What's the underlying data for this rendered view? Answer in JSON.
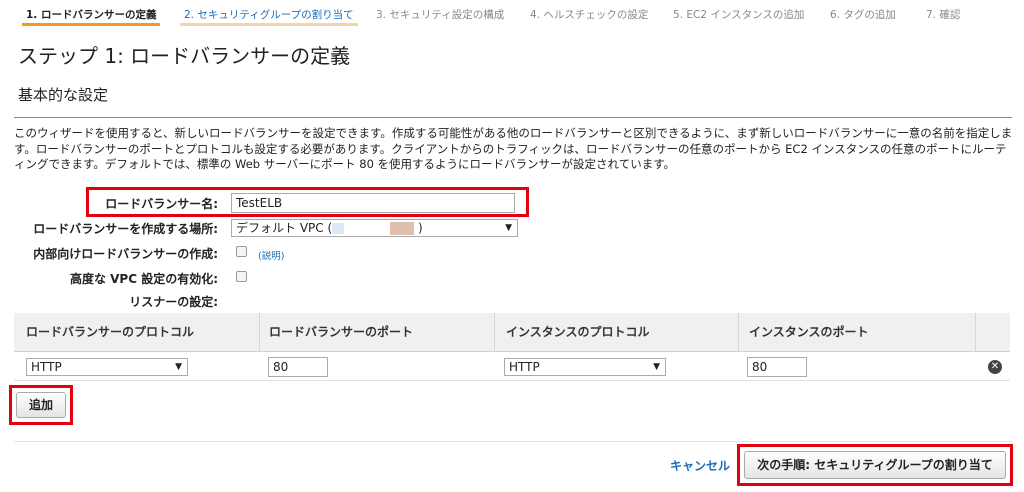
{
  "tabs": [
    {
      "label": "1. ロードバランサーの定義",
      "state": "active"
    },
    {
      "label": "2. セキュリティグループの割り当て",
      "state": "link"
    },
    {
      "label": "3. セキュリティ設定の構成",
      "state": "inactive"
    },
    {
      "label": "4. ヘルスチェックの設定",
      "state": "inactive"
    },
    {
      "label": "5. EC2 インスタンスの追加",
      "state": "inactive"
    },
    {
      "label": "6. タグの追加",
      "state": "inactive"
    },
    {
      "label": "7. 確認",
      "state": "inactive"
    }
  ],
  "page": {
    "title": "ステップ 1: ロードバランサーの定義",
    "section_title": "基本的な設定",
    "description": "このウィザードを使用すると、新しいロードバランサーを設定できます。作成する可能性がある他のロードバランサーと区別できるように、まず新しいロードバランサーに一意の名前を指定します。ロードバランサーのポートとプロトコルも設定する必要があります。クライアントからのトラフィックは、ロードバランサーの任意のポートから EC2 インスタンスの任意のポートにルーティングできます。デフォルトでは、標準の Web サーバーにポート 80 を使用するようにロードバランサーが設定されています。"
  },
  "form": {
    "name_label": "ロードバランサー名:",
    "name_value": "TestELB",
    "location_label": "ロードバランサーを作成する場所:",
    "location_value": "デフォルト VPC (",
    "location_value_end": ")",
    "internal_label": "内部向けロードバランサーの作成:",
    "internal_help": "(説明)",
    "internal_checked": false,
    "advanced_vpc_label": "高度な VPC 設定の有効化:",
    "advanced_vpc_checked": false,
    "listeners_label": "リスナーの設定:"
  },
  "listeners": {
    "headers": [
      "ロードバランサーのプロトコル",
      "ロードバランサーのポート",
      "インスタンスのプロトコル",
      "インスタンスのポート"
    ],
    "rows": [
      {
        "lb_protocol": "HTTP",
        "lb_port": "80",
        "instance_protocol": "HTTP",
        "instance_port": "80"
      }
    ],
    "add_button": "追加"
  },
  "footer": {
    "cancel_label": "キャンセル",
    "next_label": "次の手順: セキュリティグループの割り当て"
  },
  "colors": {
    "accent_orange": "#f49b1b",
    "link_blue": "#1a6db8",
    "highlight_red": "#e3000f"
  },
  "icons": {
    "remove": "close-circle-icon",
    "dropdown": "chevron-down-icon"
  }
}
